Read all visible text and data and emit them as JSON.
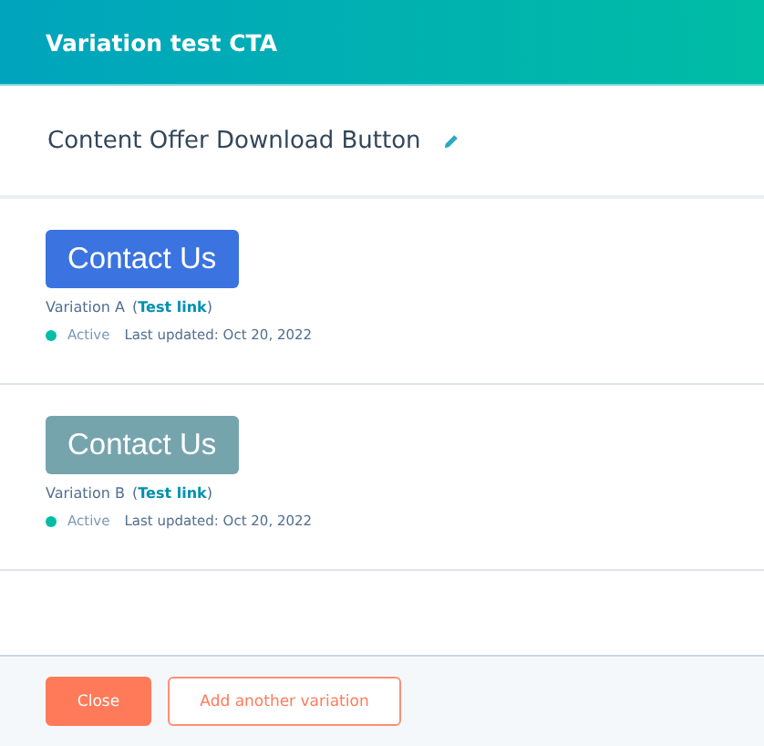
{
  "header": {
    "title": "Variation test CTA"
  },
  "cta_name": "Content Offer Download Button",
  "variations": [
    {
      "button_label": "Contact Us",
      "color": "#3b73e0",
      "name": "Variation A",
      "link": "(**Test link**)",
      "status": {
        "label": "Active",
        "color": "#00bda5"
      },
      "updated": "Last updated: Oct 20, 2022"
    },
    {
      "button_label": "Contact Us",
      "color": "#76a4ad",
      "name": "Variation B",
      "link": "(**Test link**)",
      "status": {
        "label": "Active",
        "color": "#00bda5"
      },
      "updated": "Last updated: Oct 20, 2022"
    }
  ],
  "footer": {
    "buttons": [
      {
        "label": "Close",
        "kind": "primary"
      },
      {
        "label": "Add another variation",
        "kind": "secondary"
      }
    ]
  }
}
